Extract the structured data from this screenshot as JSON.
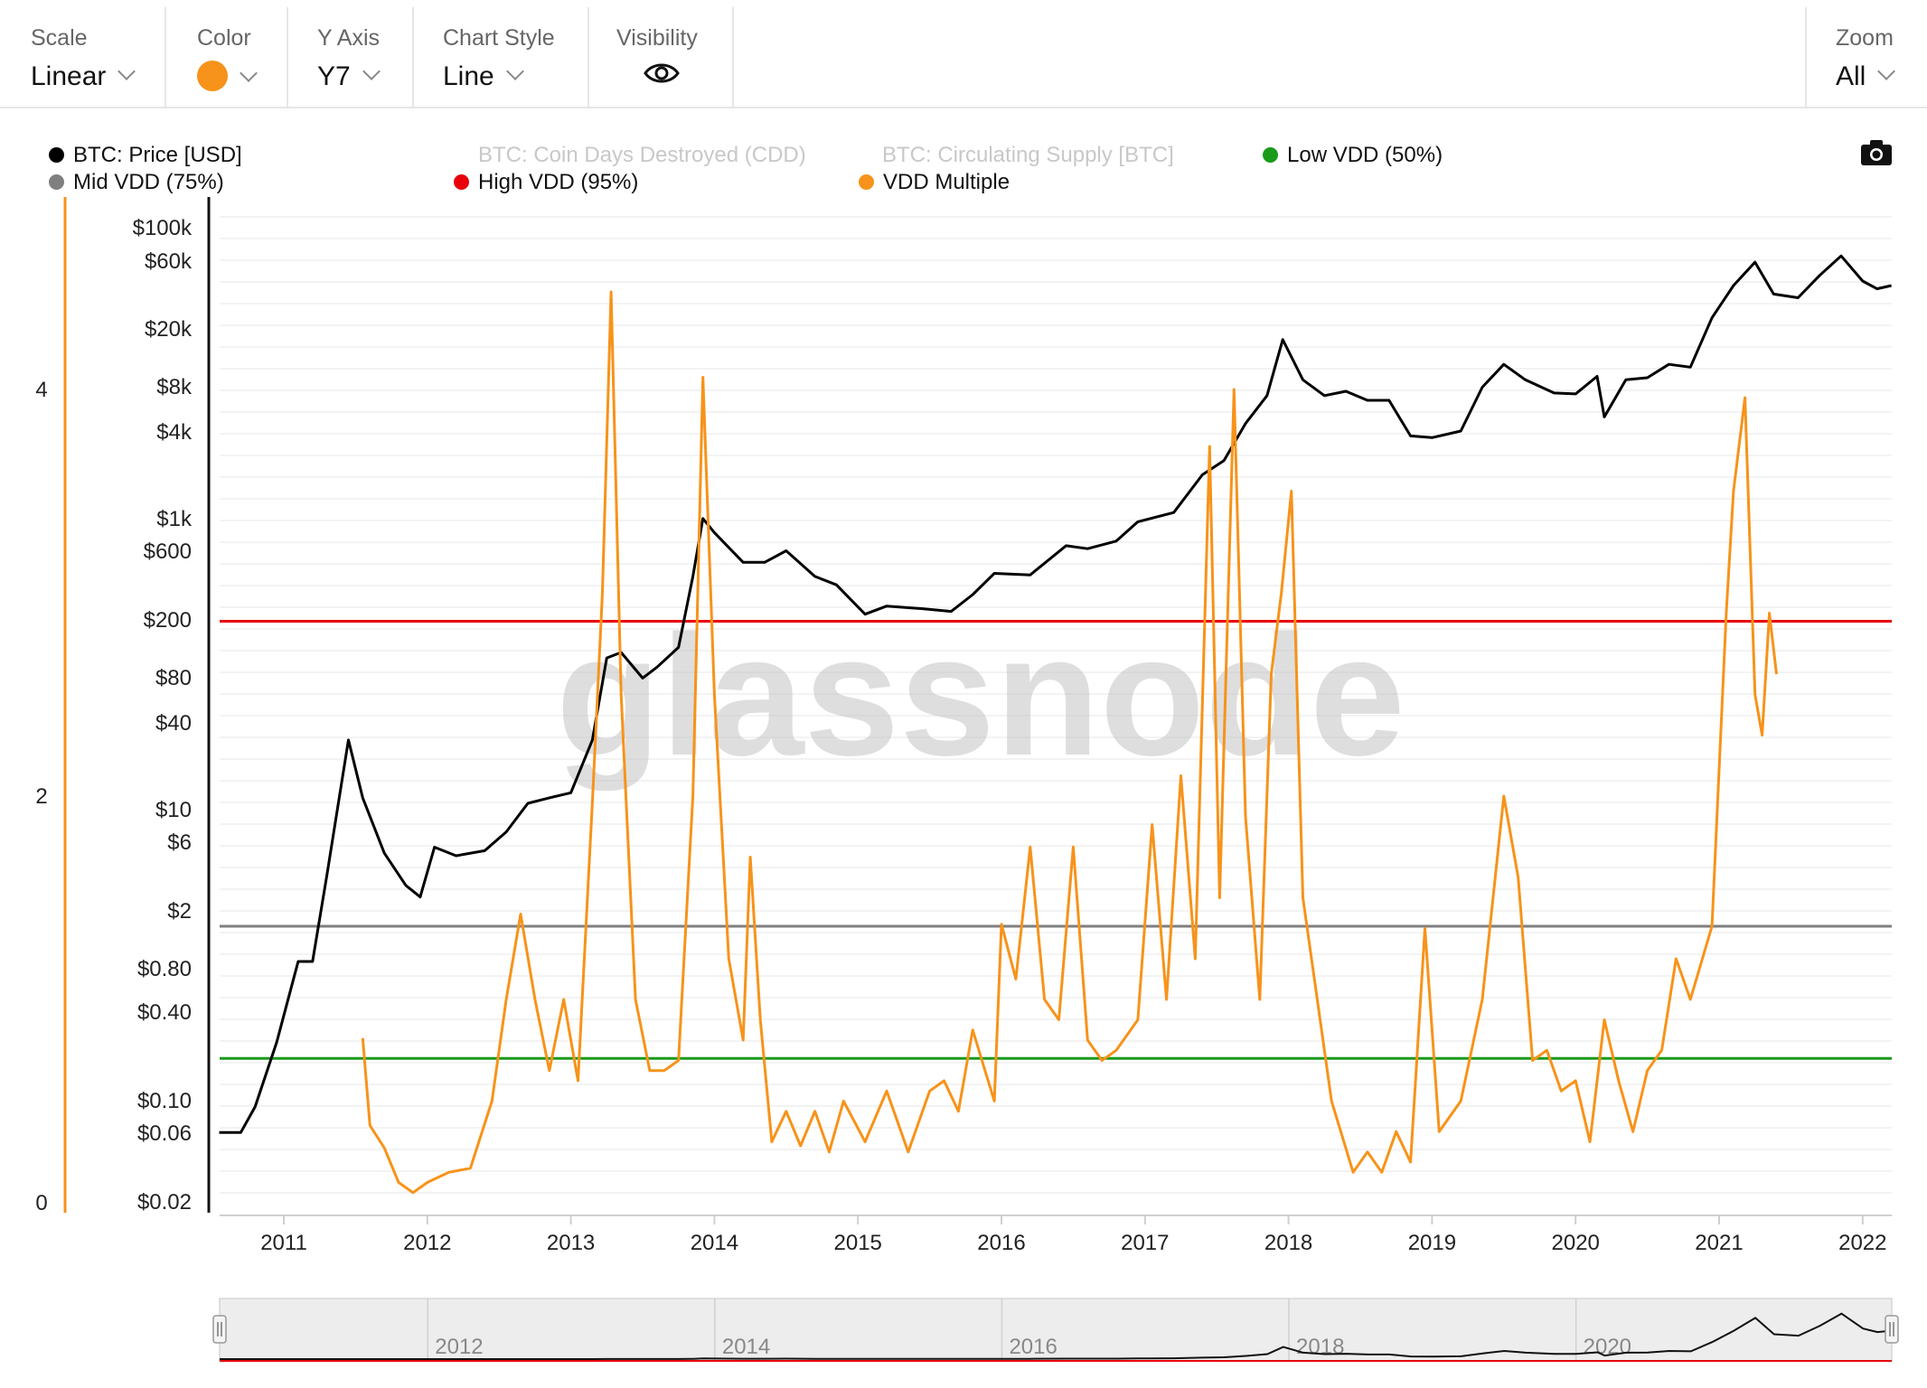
{
  "toolbar": {
    "scale": {
      "label": "Scale",
      "value": "Linear"
    },
    "color": {
      "label": "Color",
      "swatch": "#f7931a"
    },
    "yaxis": {
      "label": "Y Axis",
      "value": "Y7"
    },
    "style": {
      "label": "Chart Style",
      "value": "Line"
    },
    "visibility": {
      "label": "Visibility",
      "icon": "eye-icon"
    },
    "zoom": {
      "label": "Zoom",
      "value": "All"
    }
  },
  "legend": {
    "btc_price": "BTC: Price [USD]",
    "cdd": "BTC: Coin Days Destroyed (CDD)",
    "supply": "BTC: Circulating Supply [BTC]",
    "low_vdd": "Low VDD (50%)",
    "mid_vdd": "Mid VDD (75%)",
    "high_vdd": "High VDD (95%)",
    "vdd_multiple": "VDD Multiple",
    "camera_icon": "camera-icon"
  },
  "watermark": "glassnode",
  "colors": {
    "price": "#000000",
    "vdd": "#f7931a",
    "high": "#e8000b",
    "mid": "#7f7f7f",
    "low": "#1a9a1a",
    "disabled": "#c8c8c8"
  },
  "chart_data": {
    "type": "line",
    "x_ticks": [
      "2011",
      "2012",
      "2013",
      "2014",
      "2015",
      "2016",
      "2017",
      "2018",
      "2019",
      "2020",
      "2021",
      "2022"
    ],
    "navigator_ticks": [
      "2012",
      "2014",
      "2016",
      "2018",
      "2020"
    ],
    "price_axis_ticks": [
      "$100k",
      "$60k",
      "$20k",
      "$8k",
      "$4k",
      "$1k",
      "$600",
      "$200",
      "$80",
      "$40",
      "$10",
      "$6",
      "$2",
      "$0.80",
      "$0.40",
      "$0.10",
      "$0.06",
      "$0.02"
    ],
    "vdd_axis_ticks": [
      "4",
      "2",
      "0"
    ],
    "vdd_axis_range": [
      0,
      4.0
    ],
    "price_axis_range": [
      0.02,
      100000
    ],
    "price_scale": "log",
    "thresholds": {
      "high_vdd": 2.86,
      "mid_vdd": 1.36,
      "low_vdd": 0.71
    },
    "series": [
      {
        "name": "BTC: Price [USD]",
        "axis": "price",
        "points": [
          [
            2010.55,
            0.06
          ],
          [
            2010.7,
            0.06
          ],
          [
            2010.8,
            0.09
          ],
          [
            2010.95,
            0.25
          ],
          [
            2011.1,
            0.9
          ],
          [
            2011.2,
            0.9
          ],
          [
            2011.3,
            3.5
          ],
          [
            2011.45,
            30
          ],
          [
            2011.55,
            12
          ],
          [
            2011.7,
            5
          ],
          [
            2011.85,
            3
          ],
          [
            2011.95,
            2.5
          ],
          [
            2012.05,
            5.5
          ],
          [
            2012.2,
            4.8
          ],
          [
            2012.4,
            5.2
          ],
          [
            2012.55,
            7
          ],
          [
            2012.7,
            11
          ],
          [
            2012.85,
            12
          ],
          [
            2013.0,
            13
          ],
          [
            2013.15,
            30
          ],
          [
            2013.25,
            110
          ],
          [
            2013.35,
            120
          ],
          [
            2013.5,
            80
          ],
          [
            2013.6,
            95
          ],
          [
            2013.75,
            130
          ],
          [
            2013.85,
            400
          ],
          [
            2013.92,
            1000
          ],
          [
            2014.0,
            800
          ],
          [
            2014.2,
            500
          ],
          [
            2014.35,
            500
          ],
          [
            2014.5,
            600
          ],
          [
            2014.7,
            400
          ],
          [
            2014.85,
            350
          ],
          [
            2015.05,
            220
          ],
          [
            2015.2,
            250
          ],
          [
            2015.45,
            240
          ],
          [
            2015.65,
            230
          ],
          [
            2015.8,
            300
          ],
          [
            2015.95,
            420
          ],
          [
            2016.2,
            410
          ],
          [
            2016.45,
            650
          ],
          [
            2016.6,
            620
          ],
          [
            2016.8,
            700
          ],
          [
            2016.95,
            950
          ],
          [
            2017.2,
            1100
          ],
          [
            2017.4,
            2000
          ],
          [
            2017.55,
            2500
          ],
          [
            2017.7,
            4500
          ],
          [
            2017.85,
            7000
          ],
          [
            2017.96,
            17000
          ],
          [
            2018.1,
            9000
          ],
          [
            2018.25,
            7000
          ],
          [
            2018.4,
            7500
          ],
          [
            2018.55,
            6500
          ],
          [
            2018.7,
            6500
          ],
          [
            2018.85,
            3700
          ],
          [
            2019.0,
            3600
          ],
          [
            2019.2,
            4000
          ],
          [
            2019.35,
            8000
          ],
          [
            2019.5,
            11500
          ],
          [
            2019.65,
            9000
          ],
          [
            2019.85,
            7300
          ],
          [
            2020.0,
            7200
          ],
          [
            2020.15,
            9500
          ],
          [
            2020.2,
            5000
          ],
          [
            2020.35,
            9000
          ],
          [
            2020.5,
            9300
          ],
          [
            2020.65,
            11500
          ],
          [
            2020.8,
            11000
          ],
          [
            2020.95,
            24000
          ],
          [
            2021.1,
            40000
          ],
          [
            2021.25,
            58000
          ],
          [
            2021.38,
            35000
          ],
          [
            2021.55,
            33000
          ],
          [
            2021.7,
            47000
          ],
          [
            2021.85,
            64000
          ],
          [
            2022.0,
            43000
          ],
          [
            2022.1,
            38000
          ],
          [
            2022.2,
            40000
          ]
        ]
      },
      {
        "name": "VDD Multiple",
        "axis": "vdd",
        "points": [
          [
            2011.55,
            0.81
          ],
          [
            2011.6,
            0.38
          ],
          [
            2011.7,
            0.27
          ],
          [
            2011.8,
            0.1
          ],
          [
            2011.9,
            0.05
          ],
          [
            2012.0,
            0.1
          ],
          [
            2012.15,
            0.15
          ],
          [
            2012.3,
            0.17
          ],
          [
            2012.45,
            0.5
          ],
          [
            2012.55,
            1.0
          ],
          [
            2012.65,
            1.42
          ],
          [
            2012.75,
            1.0
          ],
          [
            2012.85,
            0.65
          ],
          [
            2012.95,
            1.0
          ],
          [
            2013.05,
            0.6
          ],
          [
            2013.15,
            1.97
          ],
          [
            2013.22,
            3.0
          ],
          [
            2013.28,
            4.48
          ],
          [
            2013.35,
            2.5
          ],
          [
            2013.45,
            1.0
          ],
          [
            2013.55,
            0.65
          ],
          [
            2013.65,
            0.65
          ],
          [
            2013.75,
            0.7
          ],
          [
            2013.85,
            2.0
          ],
          [
            2013.92,
            4.06
          ],
          [
            2014.0,
            2.5
          ],
          [
            2014.1,
            1.2
          ],
          [
            2014.2,
            0.8
          ],
          [
            2014.25,
            1.7
          ],
          [
            2014.32,
            0.9
          ],
          [
            2014.4,
            0.3
          ],
          [
            2014.5,
            0.45
          ],
          [
            2014.6,
            0.28
          ],
          [
            2014.7,
            0.45
          ],
          [
            2014.8,
            0.25
          ],
          [
            2014.9,
            0.5
          ],
          [
            2015.05,
            0.3
          ],
          [
            2015.2,
            0.55
          ],
          [
            2015.35,
            0.25
          ],
          [
            2015.5,
            0.55
          ],
          [
            2015.6,
            0.6
          ],
          [
            2015.7,
            0.45
          ],
          [
            2015.8,
            0.85
          ],
          [
            2015.95,
            0.5
          ],
          [
            2016.0,
            1.37
          ],
          [
            2016.1,
            1.1
          ],
          [
            2016.2,
            1.75
          ],
          [
            2016.3,
            1.0
          ],
          [
            2016.4,
            0.9
          ],
          [
            2016.5,
            1.75
          ],
          [
            2016.6,
            0.8
          ],
          [
            2016.7,
            0.7
          ],
          [
            2016.8,
            0.75
          ],
          [
            2016.95,
            0.9
          ],
          [
            2017.05,
            1.86
          ],
          [
            2017.15,
            1.0
          ],
          [
            2017.25,
            2.1
          ],
          [
            2017.35,
            1.2
          ],
          [
            2017.45,
            3.72
          ],
          [
            2017.52,
            1.5
          ],
          [
            2017.62,
            4.0
          ],
          [
            2017.7,
            1.9
          ],
          [
            2017.8,
            1.0
          ],
          [
            2017.88,
            2.6
          ],
          [
            2017.95,
            3.0
          ],
          [
            2018.02,
            3.5
          ],
          [
            2018.1,
            1.5
          ],
          [
            2018.2,
            1.0
          ],
          [
            2018.3,
            0.5
          ],
          [
            2018.45,
            0.15
          ],
          [
            2018.55,
            0.25
          ],
          [
            2018.65,
            0.15
          ],
          [
            2018.75,
            0.35
          ],
          [
            2018.85,
            0.2
          ],
          [
            2018.95,
            1.35
          ],
          [
            2019.05,
            0.35
          ],
          [
            2019.2,
            0.5
          ],
          [
            2019.35,
            1.0
          ],
          [
            2019.5,
            2.0
          ],
          [
            2019.6,
            1.6
          ],
          [
            2019.7,
            0.7
          ],
          [
            2019.8,
            0.75
          ],
          [
            2019.9,
            0.55
          ],
          [
            2020.0,
            0.6
          ],
          [
            2020.1,
            0.3
          ],
          [
            2020.2,
            0.9
          ],
          [
            2020.3,
            0.6
          ],
          [
            2020.4,
            0.35
          ],
          [
            2020.5,
            0.65
          ],
          [
            2020.6,
            0.75
          ],
          [
            2020.7,
            1.2
          ],
          [
            2020.8,
            1.0
          ],
          [
            2020.95,
            1.36
          ],
          [
            2021.05,
            2.9
          ],
          [
            2021.1,
            3.5
          ],
          [
            2021.18,
            3.96
          ],
          [
            2021.25,
            2.5
          ],
          [
            2021.3,
            2.3
          ],
          [
            2021.35,
            2.9
          ],
          [
            2021.4,
            2.6
          ]
        ]
      }
    ]
  }
}
